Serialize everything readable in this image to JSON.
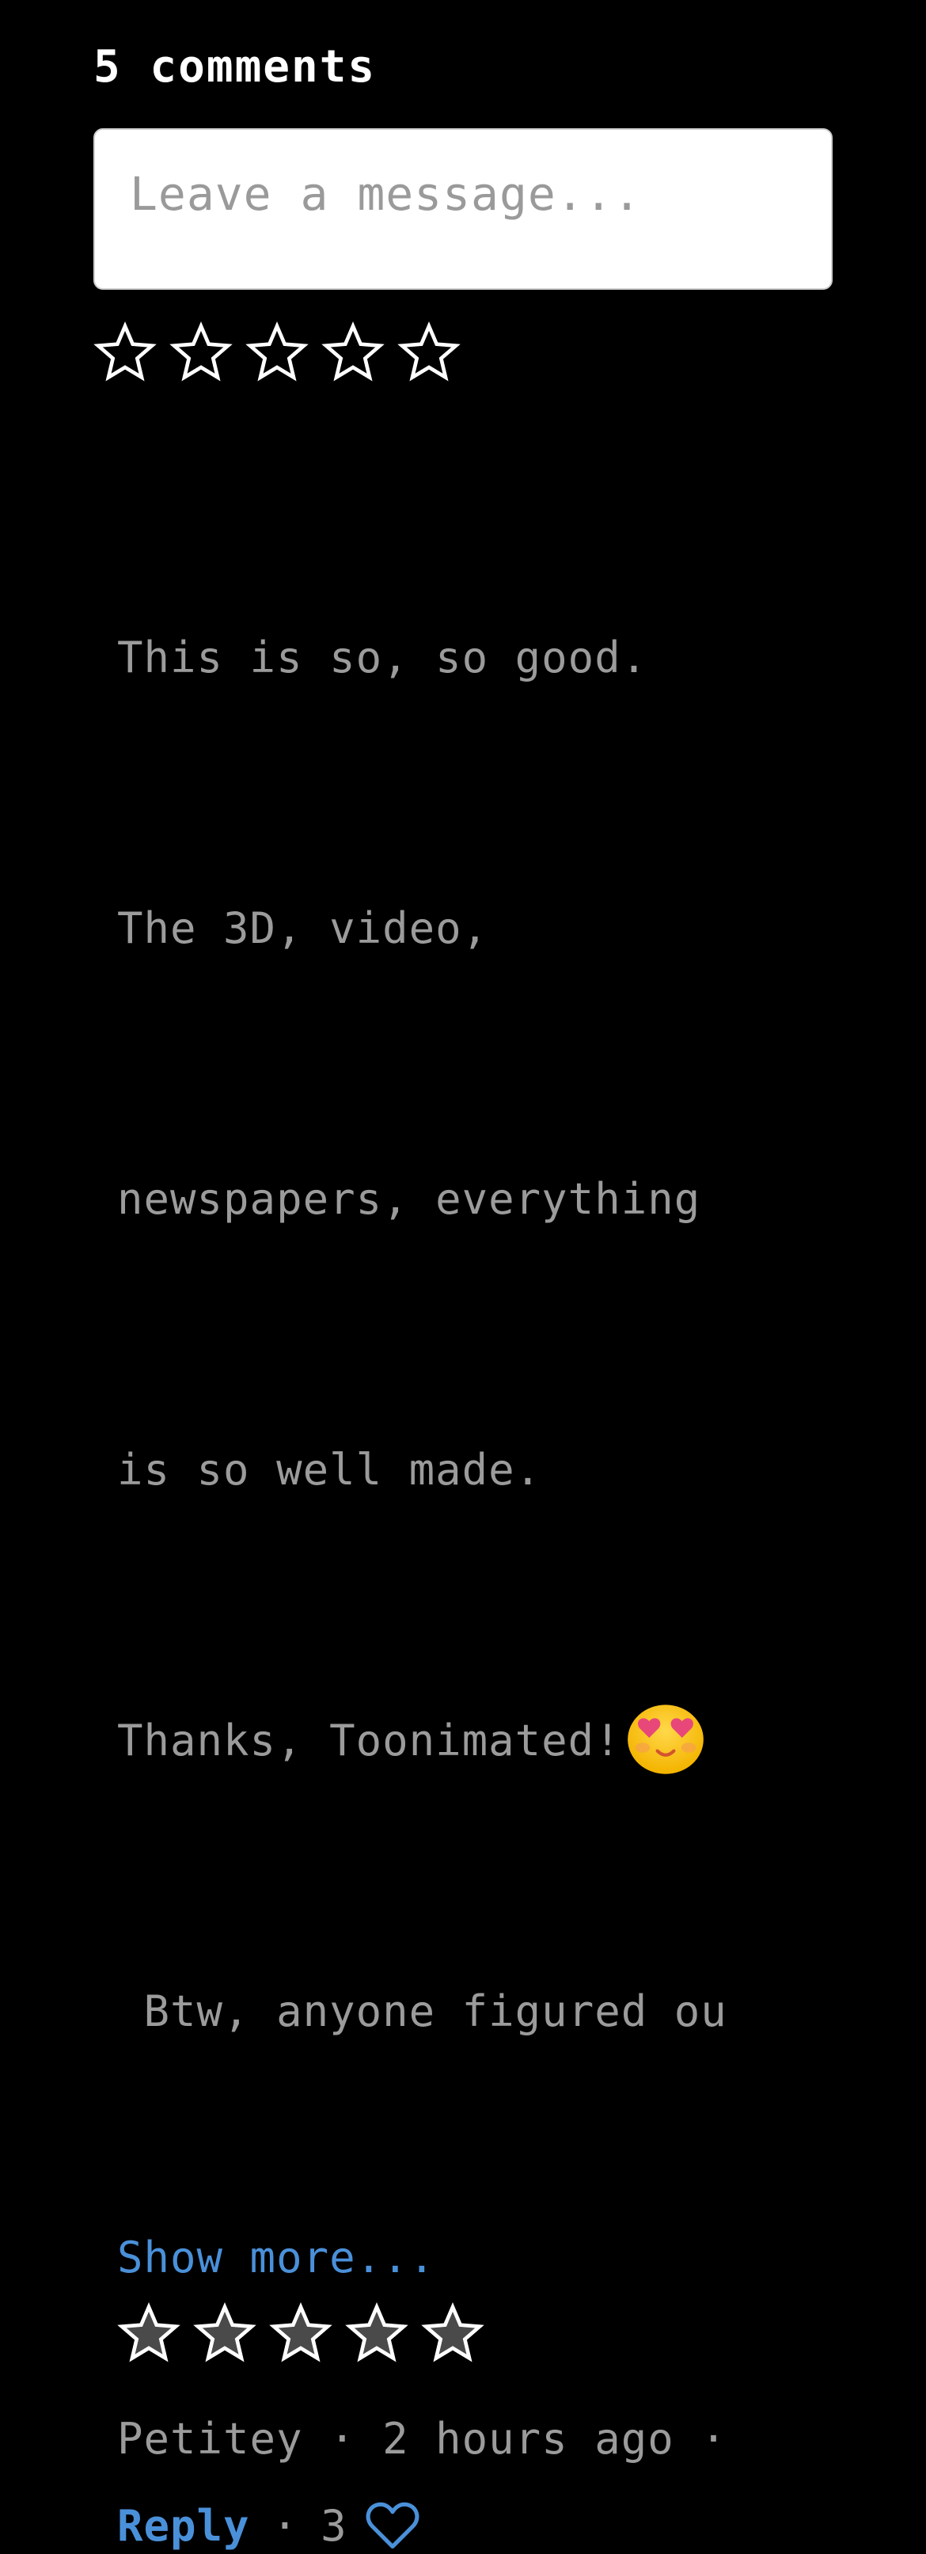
{
  "comments": {
    "count_label": "5 comments",
    "input": {
      "placeholder": "Leave a message..."
    },
    "rating_input": {
      "stars": 5,
      "selected": 0
    }
  },
  "comment": {
    "lines": [
      "This is so, so good.",
      "The 3D, video,",
      "newspapers, everything",
      "is so well made.",
      "Thanks, Toonimated!",
      " Btw, anyone figured ou"
    ],
    "emoji": "smiling-face-with-heart-eyes",
    "show_more": "Show more...",
    "rating": {
      "stars": 5,
      "filled": 5
    },
    "author": "Petitey",
    "time": "2 hours ago",
    "meta_sep": "·",
    "reply": "Reply",
    "likes": "3"
  },
  "colors": {
    "background": "#000000",
    "link": "#4a90d9",
    "muted_text": "#9b9b9b",
    "star_fill": "#4a4a4a"
  }
}
